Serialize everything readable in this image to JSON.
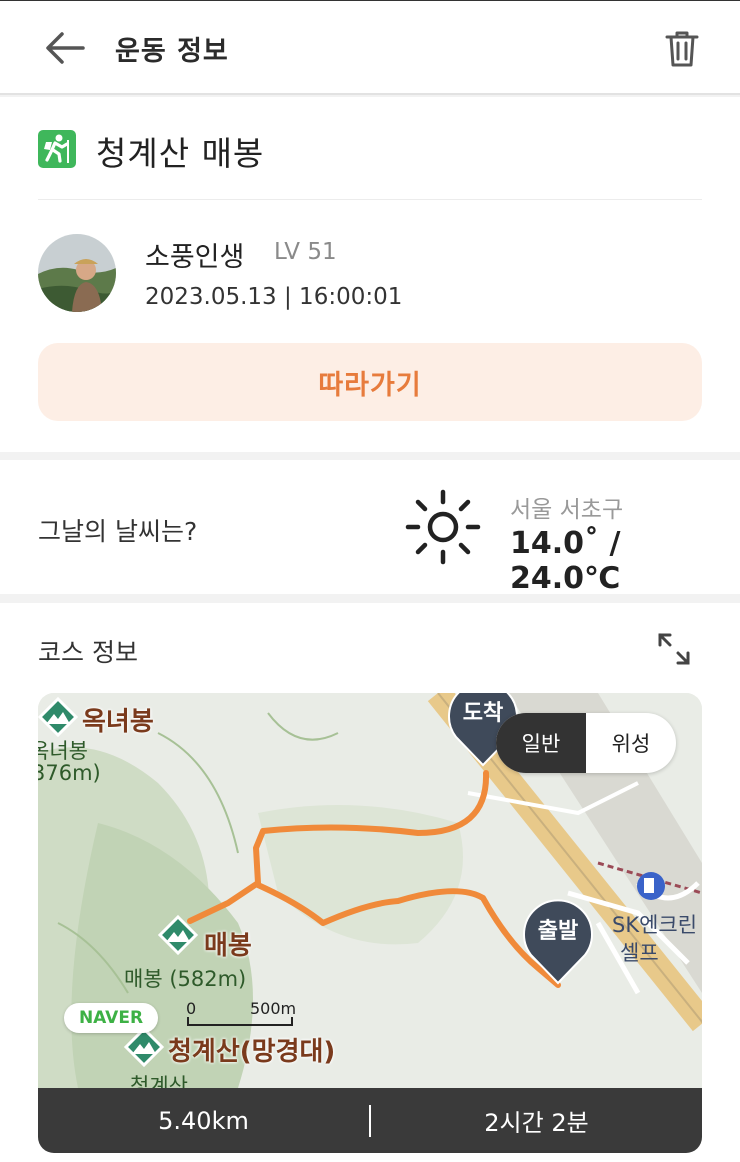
{
  "header": {
    "title": "운동 정보",
    "back_icon": "arrow-left-icon",
    "delete_icon": "trash-icon"
  },
  "activity": {
    "icon": "hiking-icon",
    "icon_color": "#3fb75b",
    "title": "청계산 매봉"
  },
  "user": {
    "name": "소풍인생",
    "level": "LV 51",
    "datetime": "2023.05.13 | 16:00:01"
  },
  "follow_button": {
    "label": "따라가기",
    "bg_color": "#fdeee5",
    "text_color": "#e77b3c"
  },
  "weather": {
    "question": "그날의 날씨는?",
    "icon": "sun-icon",
    "location": "서울 서초구",
    "temperature": "14.0˚ / 24.0℃"
  },
  "course": {
    "title": "코스 정보",
    "expand_icon": "expand-icon",
    "map": {
      "map_type_options": [
        "일반",
        "위성"
      ],
      "selected_map_type": "일반",
      "start_label": "출발",
      "end_label": "도착",
      "route_color": "#f08a3a",
      "peaks": [
        {
          "name": "옥녀봉",
          "sub": "옥녀봉",
          "elev": "376m)"
        },
        {
          "name": "매봉",
          "sub": "매봉 (582m)"
        },
        {
          "name": "청계산(망경대)",
          "sub": "청계산"
        }
      ],
      "poi_label_line1": "SK엔크린",
      "poi_label_line2": "셀프",
      "naver_label": "NAVER",
      "scale_start": "0",
      "scale_end": "500m"
    },
    "distance": "5.40km",
    "duration": "2시간 2분"
  }
}
